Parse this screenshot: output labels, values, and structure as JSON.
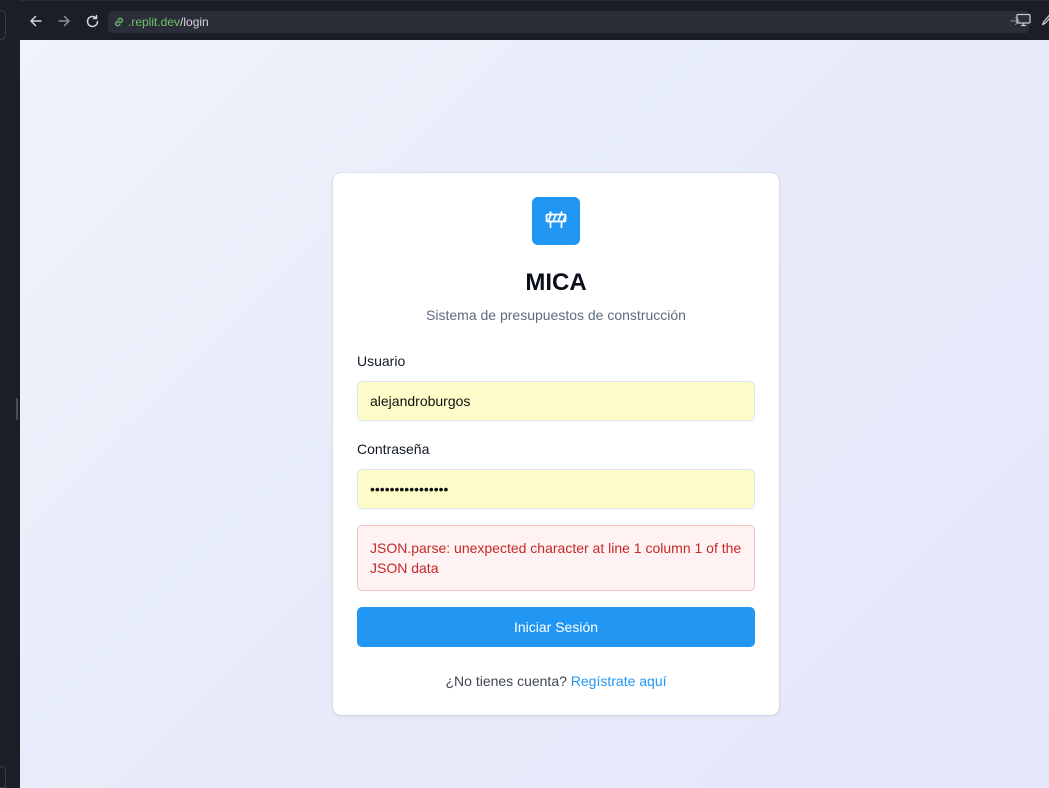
{
  "browser": {
    "url_domain": ".replit.dev",
    "url_path": "/login"
  },
  "app": {
    "logo_icon": "road-barrier-icon",
    "title": "MICA",
    "subtitle": "Sistema de presupuestos de construcción"
  },
  "form": {
    "username_label": "Usuario",
    "username_value": "alejandroburgos",
    "password_label": "Contraseña",
    "password_value": "••••••••••••••••",
    "error_message": "JSON.parse: unexpected character at line 1 column 1 of the JSON data",
    "submit_label": "Iniciar Sesión",
    "register_prompt": "¿No tienes cuenta?",
    "register_link": "Regístrate aquí"
  },
  "colors": {
    "accent": "#2196f3",
    "autofill": "#fefcc9",
    "error_text": "#c62828",
    "error_bg": "#fef2f2"
  }
}
